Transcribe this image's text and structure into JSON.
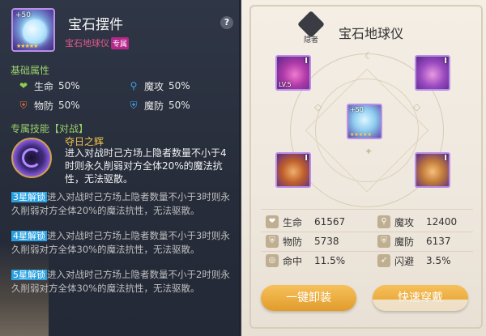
{
  "item": {
    "plus": "+50",
    "name": "宝石摆件",
    "subtitle": "宝石地球仪",
    "badge": "专属",
    "help": "?"
  },
  "base_section": {
    "title": "基础属性",
    "stats": [
      {
        "label": "生命",
        "value": "50%",
        "icon": "heart-icon",
        "color": "#8bd04a"
      },
      {
        "label": "魔攻",
        "value": "50%",
        "icon": "wand-icon",
        "color": "#3fa0e8"
      },
      {
        "label": "物防",
        "value": "50%",
        "icon": "shield-icon",
        "color": "#e06a3a"
      },
      {
        "label": "魔防",
        "value": "50%",
        "icon": "magic-shield-icon",
        "color": "#3fa0e8"
      }
    ]
  },
  "skill_section": {
    "title": "专属技能【对战】",
    "skill_name": "夺日之辉",
    "skill_desc": "进入对战时己方场上隐者数量不小于4时则永久削弱对方全体20%的魔法抗性，无法驱散。",
    "star_levels": [
      {
        "tag": "3星解锁",
        "text": "进入对战时己方场上隐者数量不小于3时则永久削弱对方全体20%的魔法抗性，无法驱散。"
      },
      {
        "tag": "4星解锁",
        "text": "进入对战时己方场上隐者数量不小于3时则永久削弱对方全体30%的魔法抗性，无法驱散。"
      },
      {
        "tag": "5星解锁",
        "text": "进入对战时己方场上隐者数量不小于2时则永久削弱对方全体30%的魔法抗性，无法驱散。"
      }
    ]
  },
  "right": {
    "class_label": "隐者",
    "title": "宝石地球仪",
    "slots": [
      {
        "rank": "I",
        "lv": "LV.5"
      },
      {
        "rank": "I"
      },
      {
        "plus": "+50",
        "stars": "★★★★★"
      },
      {
        "rank": "I"
      },
      {
        "rank": "I"
      }
    ],
    "stats": [
      {
        "label": "生命",
        "value": "61567",
        "icon": "heart-icon"
      },
      {
        "label": "魔攻",
        "value": "12400",
        "icon": "wand-icon"
      },
      {
        "label": "物防",
        "value": "5738",
        "icon": "shield-icon"
      },
      {
        "label": "魔防",
        "value": "6137",
        "icon": "magic-shield-icon"
      },
      {
        "label": "命中",
        "value": "11.5%",
        "icon": "target-icon"
      },
      {
        "label": "闪避",
        "value": "3.5%",
        "icon": "dodge-icon"
      }
    ],
    "btn_unequip": "一键卸装",
    "btn_quick": "快速穿戴"
  },
  "colors": {
    "accent_gold": "#e29b2c",
    "star_tag_blue": "#2aa0e0",
    "section_green": "#9ad06a",
    "item_pink": "#e65a8e"
  }
}
